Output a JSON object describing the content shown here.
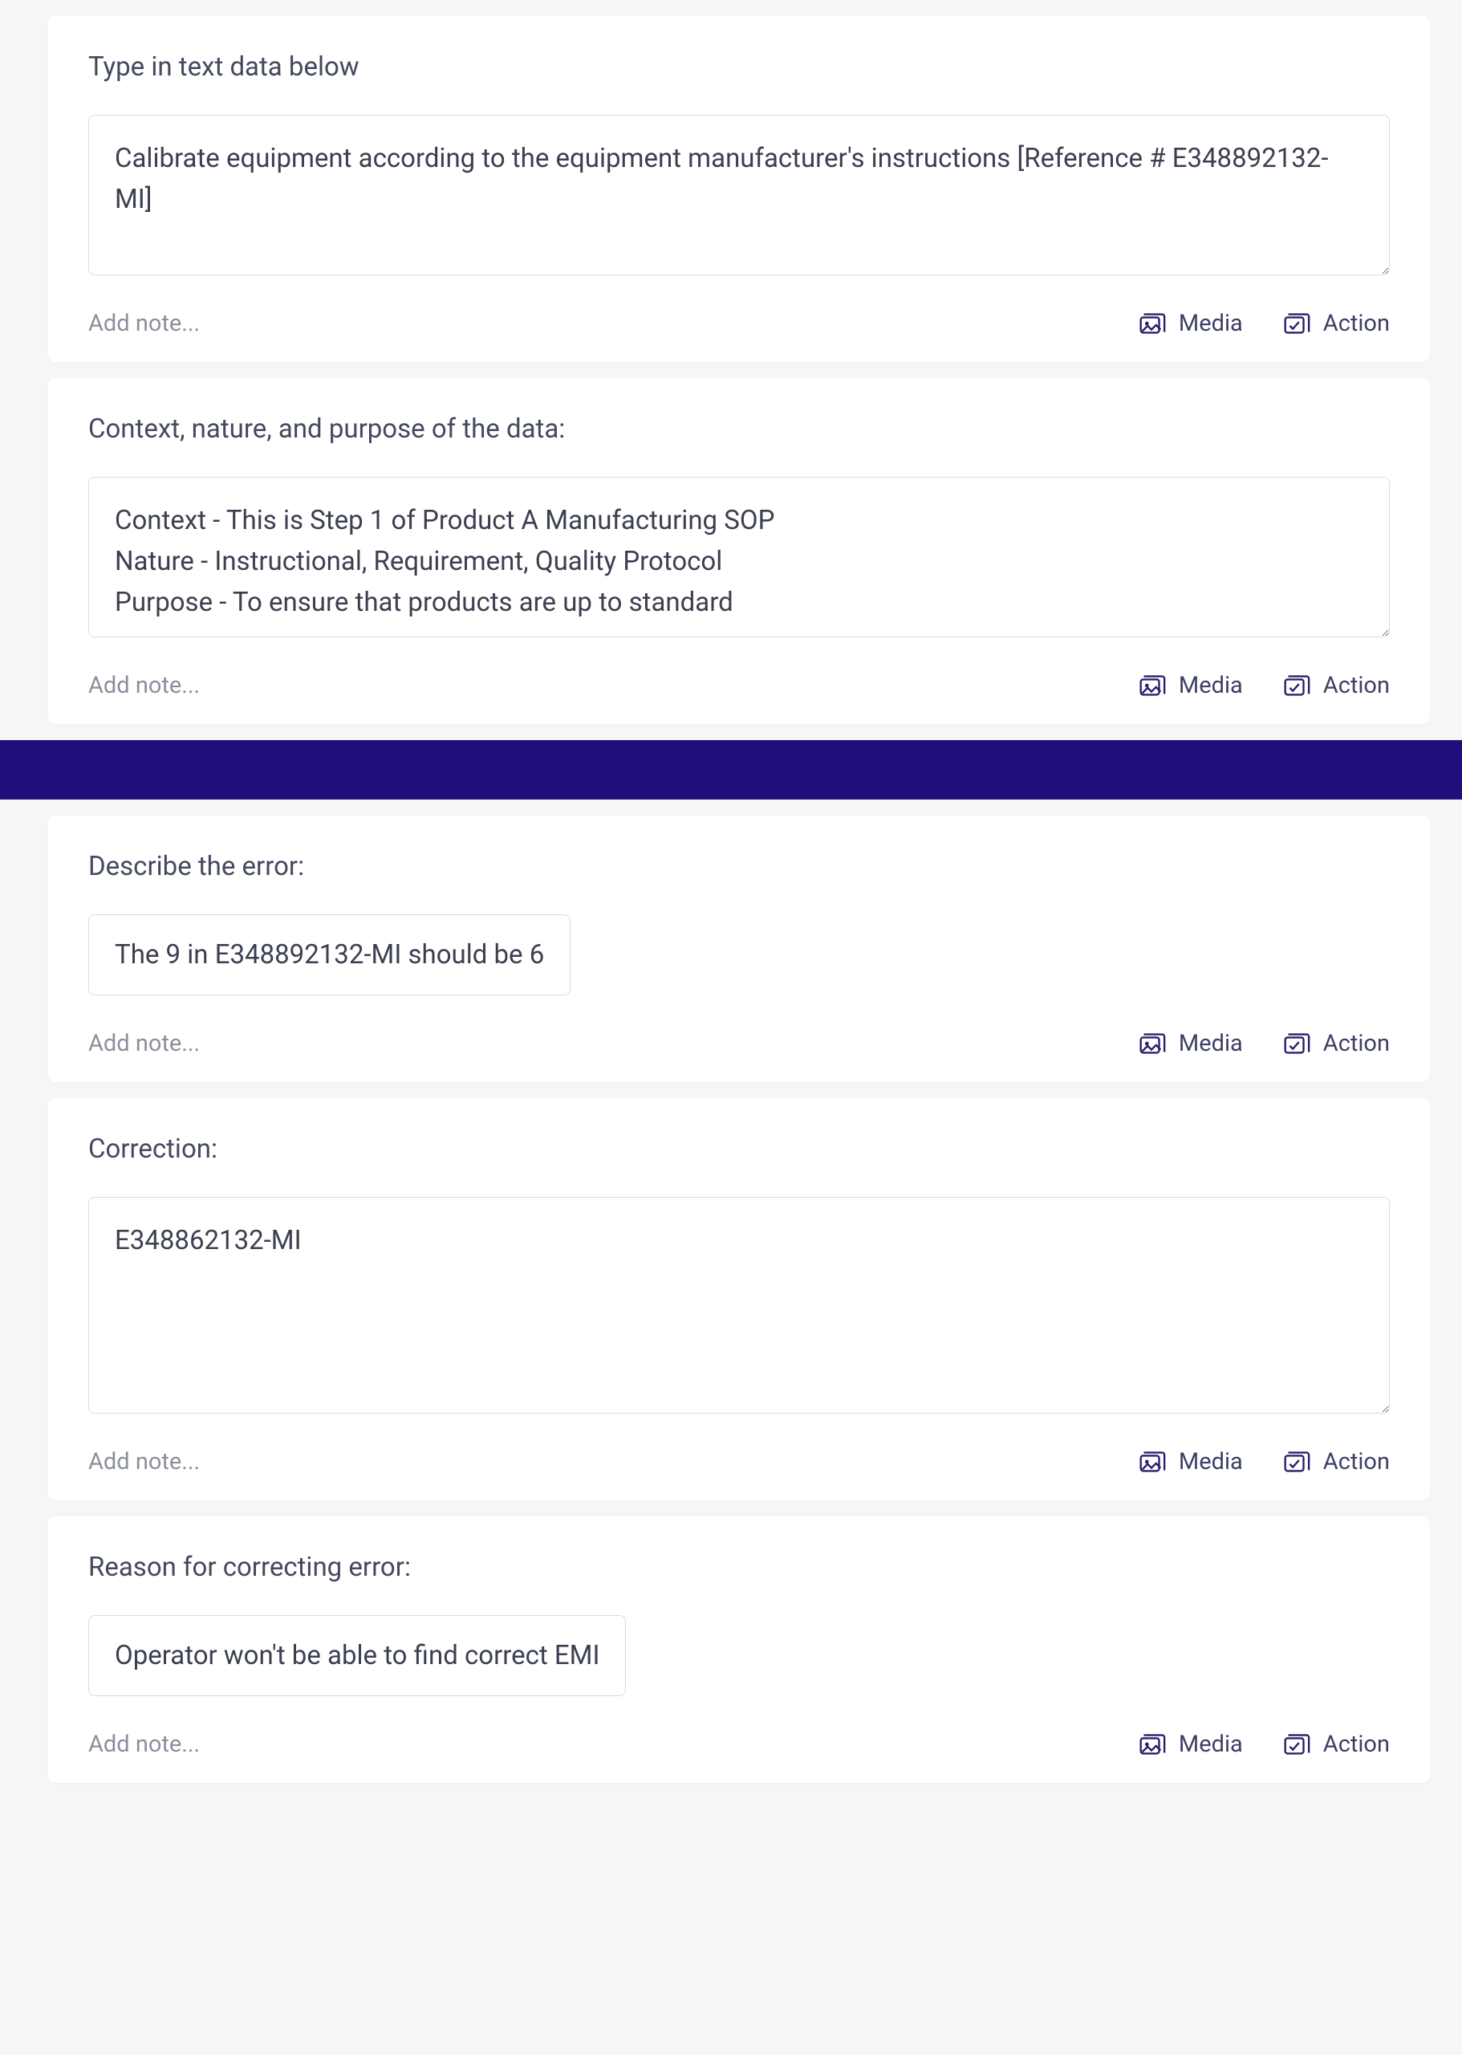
{
  "sections": [
    {
      "id": "text-data",
      "label": "Type in text data below",
      "value": "Calibrate equipment according to the equipment manufacturer's instructions [Reference # E348892132-MI]",
      "height": "medium",
      "add_note_placeholder": "Add note...",
      "media_label": "Media",
      "action_label": "Action"
    },
    {
      "id": "context",
      "label": "Context, nature, and purpose of the data:",
      "value": "Context - This is Step 1 of Product A Manufacturing SOP\nNature - Instructional, Requirement, Quality Protocol\nPurpose - To ensure that products are up to standard",
      "height": "medium",
      "add_note_placeholder": "Add note...",
      "media_label": "Media",
      "action_label": "Action"
    }
  ],
  "sections_after": [
    {
      "id": "describe-error",
      "label": "Describe the error:",
      "value": "The 9 in E348892132-MI should be 6",
      "fit_content": true,
      "add_note_placeholder": "Add note...",
      "media_label": "Media",
      "action_label": "Action"
    },
    {
      "id": "correction",
      "label": "Correction:",
      "value": "E348862132-MI",
      "height": "tall",
      "add_note_placeholder": "Add note...",
      "media_label": "Media",
      "action_label": "Action"
    },
    {
      "id": "reason",
      "label": "Reason for correcting error:",
      "value": "Operator won't be able to find correct EMI",
      "fit_content": true,
      "add_note_placeholder": "Add note...",
      "media_label": "Media",
      "action_label": "Action"
    }
  ],
  "divider_color": "#210d7b",
  "icons": {
    "media": "media-stack-icon",
    "action": "check-stack-icon"
  }
}
